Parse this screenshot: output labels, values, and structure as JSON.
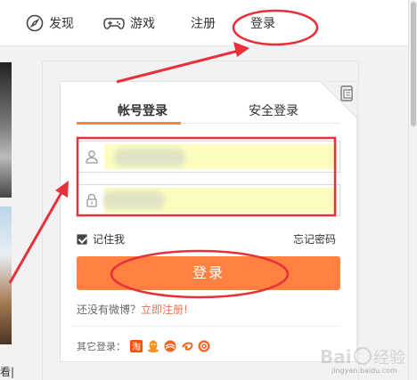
{
  "nav": {
    "items": [
      {
        "label": "发现",
        "icon": "compass-icon"
      },
      {
        "label": "游戏",
        "icon": "gamepad-icon"
      },
      {
        "label": "注册"
      },
      {
        "label": "登录"
      }
    ]
  },
  "sidebar": {
    "cut_text": "看|"
  },
  "login": {
    "tabs": [
      {
        "label": "帐号登录",
        "active": true
      },
      {
        "label": "安全登录",
        "active": false
      }
    ],
    "username_field": {
      "value": "",
      "icon": "user-icon"
    },
    "password_field": {
      "value": "",
      "icon": "lock-icon"
    },
    "remember_label": "记住我",
    "remember_checked": true,
    "forgot_label": "忘记密码",
    "submit_label": "登录",
    "no_account_text": "还没有微博？",
    "register_link": "立即注册!",
    "other_login_label": "其它登录：",
    "other_login_icons": [
      "taobao-icon",
      "qq-icon",
      "tianyi-icon",
      "link-icon",
      "weibo-alt-icon"
    ],
    "corner_icon": "qrcode-device-icon"
  },
  "colors": {
    "accent": "#ff8140",
    "annotation": "#e8303a",
    "autofill": "#fbfcbe",
    "link": "#eb7350"
  },
  "watermark": {
    "text": "jingyan.baidu.com"
  }
}
